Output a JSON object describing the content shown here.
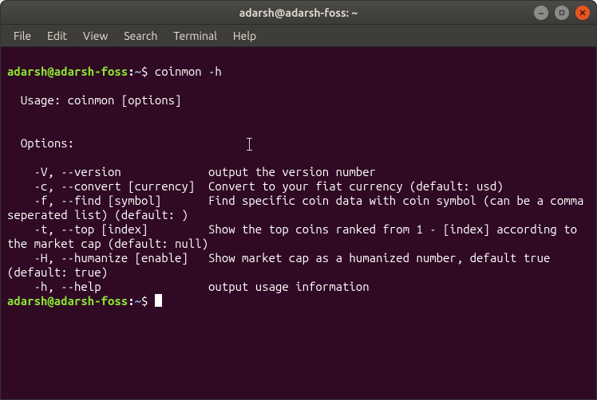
{
  "window": {
    "title": "adarsh@adarsh-foss: ~"
  },
  "menubar": {
    "items": [
      "File",
      "Edit",
      "View",
      "Search",
      "Terminal",
      "Help"
    ]
  },
  "prompt": {
    "user_host": "adarsh@adarsh-foss",
    "colon": ":",
    "path": "~",
    "dollar": "$"
  },
  "lines": {
    "cmd1": " coinmon -h",
    "blank": "",
    "usage": "  Usage: coinmon [options]",
    "options_hdr": "  Options:",
    "opt_v": "    -V, --version             output the version number",
    "opt_c": "    -c, --convert [currency]  Convert to your fiat currency (default: usd)",
    "opt_f": "    -f, --find [symbol]       Find specific coin data with coin symbol (can be a comma seperated list) (default: )",
    "opt_t": "    -t, --top [index]         Show the top coins ranked from 1 - [index] according to the market cap (default: null)",
    "opt_H": "    -H, --humanize [enable]   Show market cap as a humanized number, default true (default: true)",
    "opt_h": "    -h, --help                output usage information",
    "cmd2": " "
  }
}
